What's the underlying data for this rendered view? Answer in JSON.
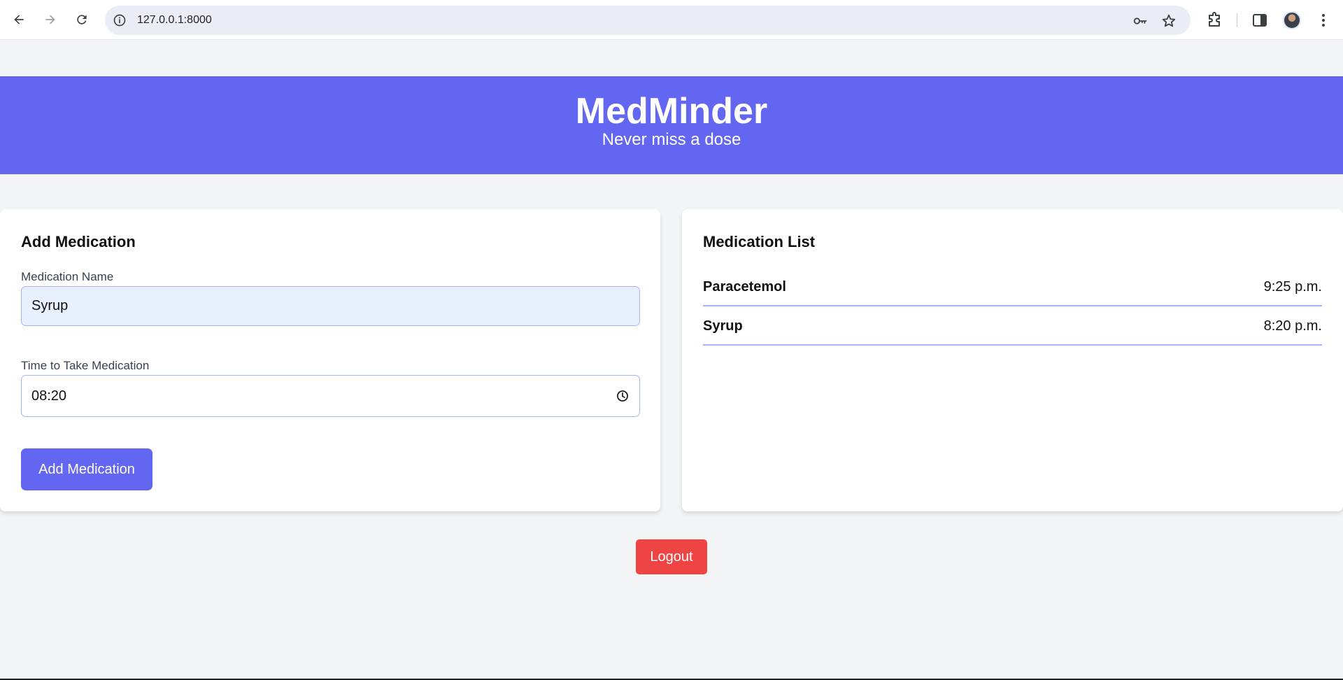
{
  "browser": {
    "url": "127.0.0.1:8000",
    "icons": [
      "back-arrow-icon",
      "forward-arrow-icon",
      "reload-icon",
      "site-info-icon",
      "password-key-icon",
      "bookmark-star-icon",
      "extensions-icon",
      "side-panel-icon",
      "profile-avatar",
      "menu-dots-icon"
    ]
  },
  "header": {
    "title": "MedMinder",
    "tagline": "Never miss a dose"
  },
  "add_form": {
    "title": "Add Medication",
    "name_label": "Medication Name",
    "name_value": "Syrup",
    "time_label": "Time to Take Medication",
    "time_value": "08:20",
    "submit_label": "Add Medication"
  },
  "med_list": {
    "title": "Medication List",
    "items": [
      {
        "name": "Paracetemol",
        "time": "9:25 p.m."
      },
      {
        "name": "Syrup",
        "time": "8:20 p.m."
      }
    ]
  },
  "logout_label": "Logout",
  "colors": {
    "primary": "#6366f1",
    "danger": "#ef4444",
    "background": "#f3f4f6",
    "divider": "#a5b4fc"
  }
}
